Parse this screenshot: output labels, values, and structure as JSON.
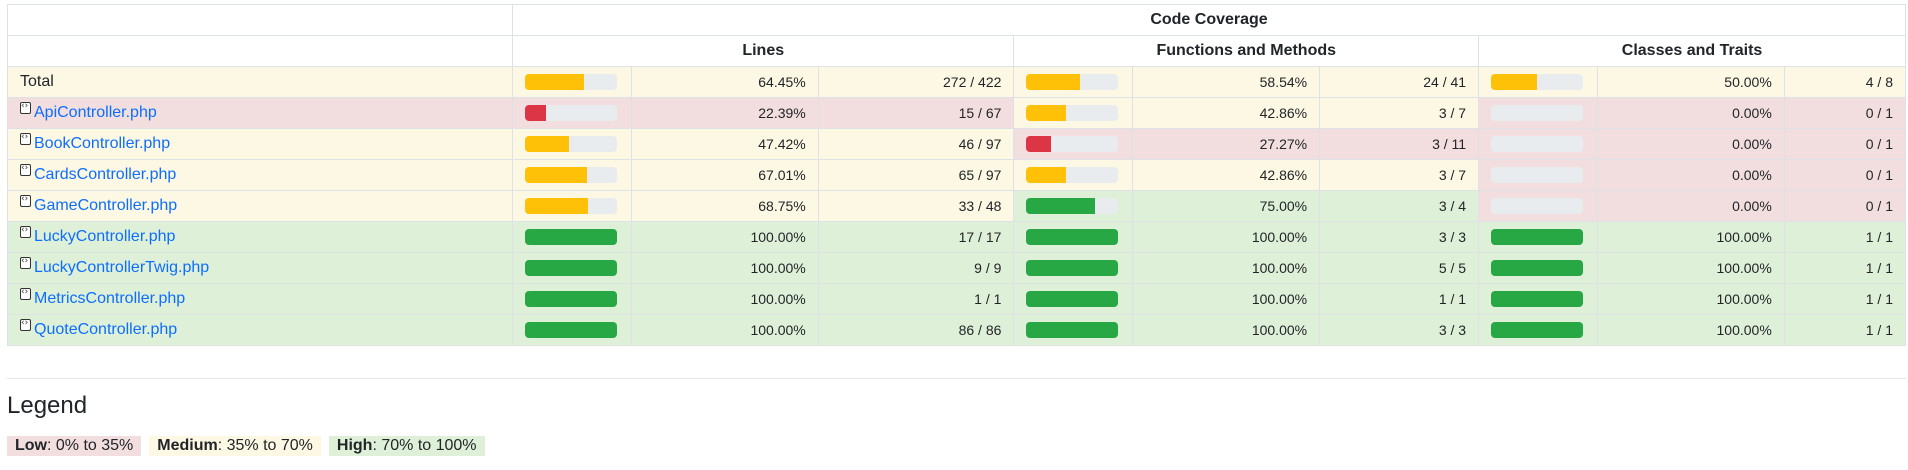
{
  "header": {
    "top": "Code Coverage",
    "lines": "Lines",
    "functions": "Functions and Methods",
    "classes": "Classes and Traits"
  },
  "colors": {
    "low": "#dc3545",
    "medium": "#ffc107",
    "high": "#28a745",
    "link": "#0d6efd"
  },
  "rows": [
    {
      "name": "Total",
      "file": false,
      "level": "medium",
      "lines": {
        "pct": "64.45%",
        "ratio": "272 / 422",
        "fill": 64.45,
        "level": "medium"
      },
      "funcs": {
        "pct": "58.54%",
        "ratio": "24 / 41",
        "fill": 58.54,
        "level": "medium"
      },
      "classes": {
        "pct": "50.00%",
        "ratio": "4 / 8",
        "fill": 50.0,
        "level": "medium"
      }
    },
    {
      "name": "ApiController.php",
      "file": true,
      "level": "low",
      "lines": {
        "pct": "22.39%",
        "ratio": "15 / 67",
        "fill": 22.39,
        "level": "low"
      },
      "funcs": {
        "pct": "42.86%",
        "ratio": "3 / 7",
        "fill": 42.86,
        "level": "medium"
      },
      "classes": {
        "pct": "0.00%",
        "ratio": "0 / 1",
        "fill": 0,
        "level": "low"
      }
    },
    {
      "name": "BookController.php",
      "file": true,
      "level": "medium",
      "lines": {
        "pct": "47.42%",
        "ratio": "46 / 97",
        "fill": 47.42,
        "level": "medium"
      },
      "funcs": {
        "pct": "27.27%",
        "ratio": "3 / 11",
        "fill": 27.27,
        "level": "low"
      },
      "classes": {
        "pct": "0.00%",
        "ratio": "0 / 1",
        "fill": 0,
        "level": "low"
      }
    },
    {
      "name": "CardsController.php",
      "file": true,
      "level": "medium",
      "lines": {
        "pct": "67.01%",
        "ratio": "65 / 97",
        "fill": 67.01,
        "level": "medium"
      },
      "funcs": {
        "pct": "42.86%",
        "ratio": "3 / 7",
        "fill": 42.86,
        "level": "medium"
      },
      "classes": {
        "pct": "0.00%",
        "ratio": "0 / 1",
        "fill": 0,
        "level": "low"
      }
    },
    {
      "name": "GameController.php",
      "file": true,
      "level": "medium",
      "lines": {
        "pct": "68.75%",
        "ratio": "33 / 48",
        "fill": 68.75,
        "level": "medium"
      },
      "funcs": {
        "pct": "75.00%",
        "ratio": "3 / 4",
        "fill": 75.0,
        "level": "high"
      },
      "classes": {
        "pct": "0.00%",
        "ratio": "0 / 1",
        "fill": 0,
        "level": "low"
      }
    },
    {
      "name": "LuckyController.php",
      "file": true,
      "level": "high",
      "lines": {
        "pct": "100.00%",
        "ratio": "17 / 17",
        "fill": 100,
        "level": "high"
      },
      "funcs": {
        "pct": "100.00%",
        "ratio": "3 / 3",
        "fill": 100,
        "level": "high"
      },
      "classes": {
        "pct": "100.00%",
        "ratio": "1 / 1",
        "fill": 100,
        "level": "high"
      }
    },
    {
      "name": "LuckyControllerTwig.php",
      "file": true,
      "level": "high",
      "lines": {
        "pct": "100.00%",
        "ratio": "9 / 9",
        "fill": 100,
        "level": "high"
      },
      "funcs": {
        "pct": "100.00%",
        "ratio": "5 / 5",
        "fill": 100,
        "level": "high"
      },
      "classes": {
        "pct": "100.00%",
        "ratio": "1 / 1",
        "fill": 100,
        "level": "high"
      }
    },
    {
      "name": "MetricsController.php",
      "file": true,
      "level": "high",
      "lines": {
        "pct": "100.00%",
        "ratio": "1 / 1",
        "fill": 100,
        "level": "high"
      },
      "funcs": {
        "pct": "100.00%",
        "ratio": "1 / 1",
        "fill": 100,
        "level": "high"
      },
      "classes": {
        "pct": "100.00%",
        "ratio": "1 / 1",
        "fill": 100,
        "level": "high"
      }
    },
    {
      "name": "QuoteController.php",
      "file": true,
      "level": "high",
      "lines": {
        "pct": "100.00%",
        "ratio": "86 / 86",
        "fill": 100,
        "level": "high"
      },
      "funcs": {
        "pct": "100.00%",
        "ratio": "3 / 3",
        "fill": 100,
        "level": "high"
      },
      "classes": {
        "pct": "100.00%",
        "ratio": "1 / 1",
        "fill": 100,
        "level": "high"
      }
    }
  ],
  "legend": {
    "title": "Legend",
    "low_label": "Low",
    "low_range": ": 0% to 35%",
    "medium_label": "Medium",
    "medium_range": ": 35% to 70%",
    "high_label": "High",
    "high_range": ": 70% to 100%"
  }
}
